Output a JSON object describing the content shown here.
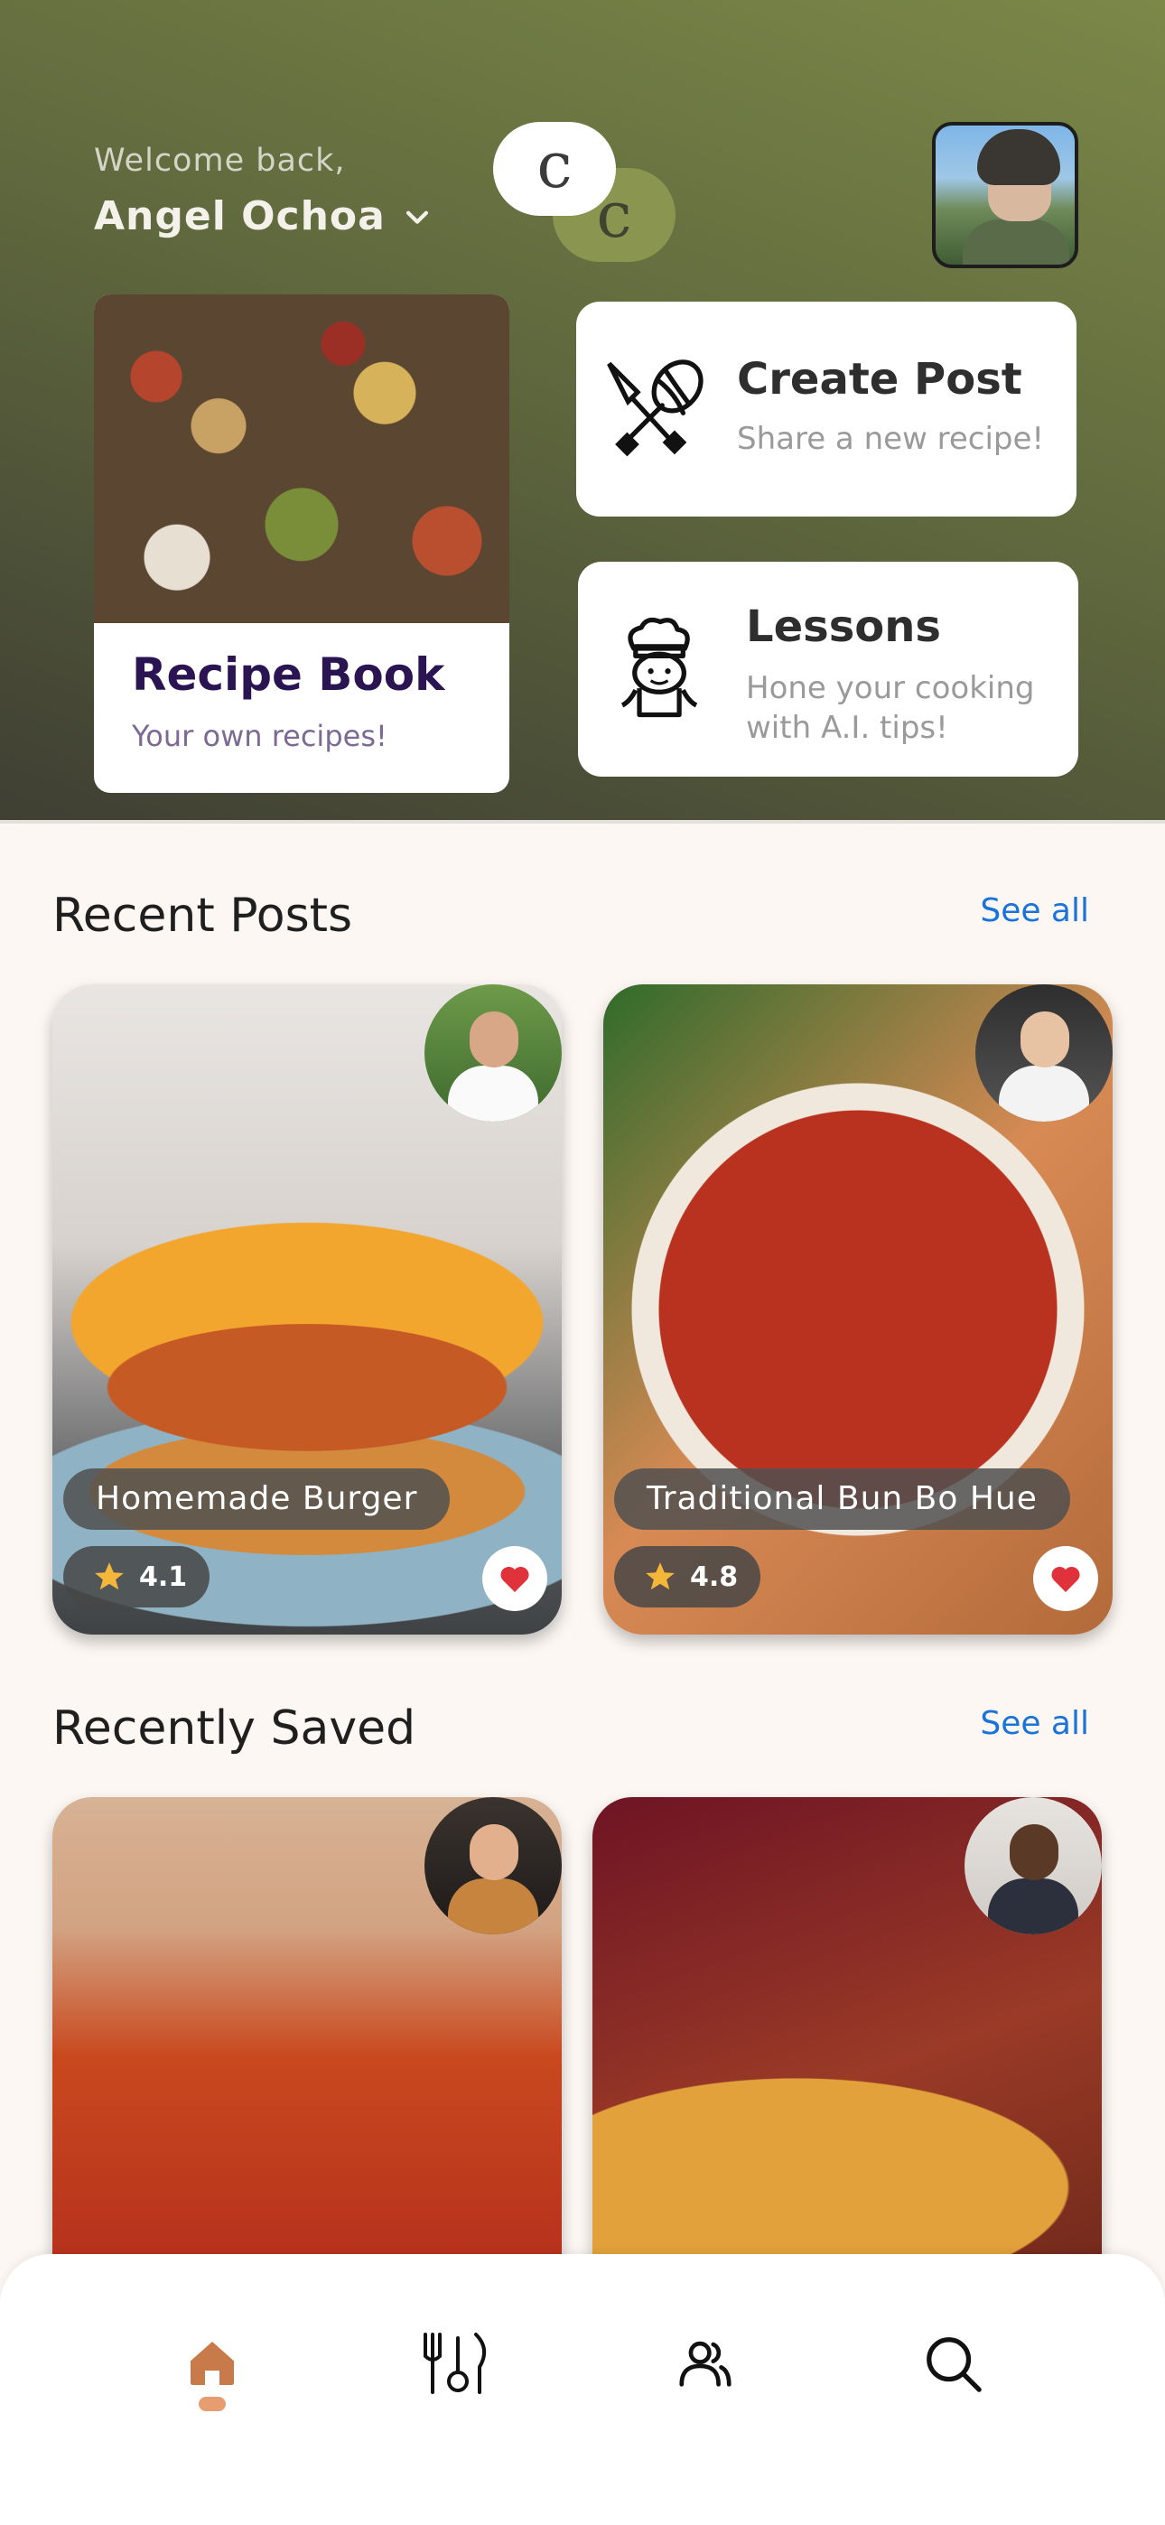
{
  "header": {
    "welcome": "Welcome back,",
    "user_name": "Angel Ochoa",
    "logo_letter": "c"
  },
  "recipe_book": {
    "title": "Recipe Book",
    "subtitle": "Your own recipes!"
  },
  "actions": [
    {
      "title": "Create Post",
      "subtitle": "Share a new recipe!",
      "icon": "whisk-spatula-icon"
    },
    {
      "title": "Lessons",
      "subtitle": "Hone your cooking with A.I. tips!",
      "icon": "chef-icon"
    }
  ],
  "recent_posts": {
    "title": "Recent Posts",
    "see_all": "See all",
    "items": [
      {
        "name": "Homemade Burger",
        "rating": "4.1",
        "liked": true
      },
      {
        "name": "Traditional Bun Bo Hue",
        "rating": "4.8",
        "liked": true
      }
    ]
  },
  "recently_saved": {
    "title": "Recently Saved",
    "see_all": "See all"
  },
  "bottom_nav": {
    "items": [
      "home-icon",
      "dining-icon",
      "community-icon",
      "search-icon"
    ],
    "active": "home-icon",
    "accent": "#c97a4b"
  },
  "colors": {
    "link": "#1a73d9",
    "recipe_title": "#2a1552",
    "heart": "#e0323a",
    "star": "#f5b73a"
  }
}
